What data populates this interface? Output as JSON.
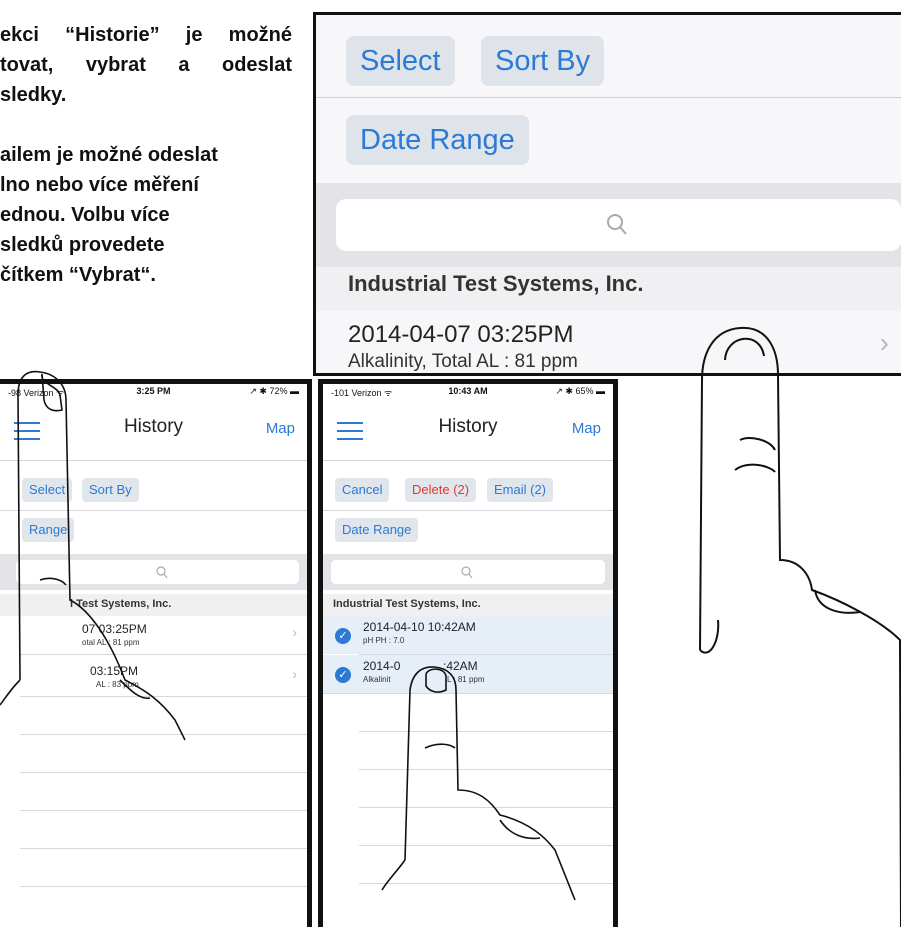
{
  "instructions": {
    "para1_lines": [
      "ekci “Historie” je možné",
      "tovat, vybrat a odeslat",
      "sledky."
    ],
    "para2_lines": [
      "ailem je možné odeslat",
      "lno nebo více měření",
      "ednou. Volbu více",
      "sledků provedete",
      "čítkem “Vybrat“."
    ]
  },
  "zoom_panel": {
    "select_label": "Select",
    "sort_label": "Sort By",
    "date_range_label": "Date Range",
    "section_header": "Industrial Test Systems, Inc.",
    "row_title": "2014-04-07 03:25PM",
    "row_subtitle": "Alkalinity, Total AL : 81 ppm"
  },
  "phone1": {
    "status_carrier": "-98 Verizon ᯤ",
    "status_time": "3:25 PM",
    "status_battery": "↗ ✱ 72% ▬",
    "title": "History",
    "map_label": "Map",
    "select_label": "Select",
    "sort_label": "Sort By",
    "date_range_label": "Range",
    "section_header": "l Test Systems, Inc.",
    "rows": [
      {
        "title": "07 03:25PM",
        "subtitle": "otal AL : 81 ppm"
      },
      {
        "title": "03:15PM",
        "subtitle": "AL : 83 ppm"
      }
    ]
  },
  "phone2": {
    "status_carrier": "-101 Verizon ᯤ",
    "status_time": "10:43 AM",
    "status_battery": "↗ ✱ 65% ▬",
    "title": "History",
    "map_label": "Map",
    "cancel_label": "Cancel",
    "delete_label": "Delete (2)",
    "email_label": "Email (2)",
    "date_range_label": "Date Range",
    "section_header": "Industrial Test Systems, Inc.",
    "rows": [
      {
        "title": "2014-04-10 10:42AM",
        "subtitle": "pH PH : 7.0"
      },
      {
        "title": "2014-0",
        "title_end": ":42AM",
        "subtitle": "Alkalinit",
        "subtitle_end": "L : 81 ppm"
      }
    ]
  },
  "icons": {
    "search": "search-icon",
    "menu": "hamburger-menu-icon",
    "chevron": "chevron-right-icon",
    "check": "checkmark-circle-icon",
    "hand": "pointing-hand-illustration"
  },
  "colors": {
    "accent": "#2a7ad6",
    "delete": "#e23b2e",
    "selected_row": "#e6eef8"
  }
}
